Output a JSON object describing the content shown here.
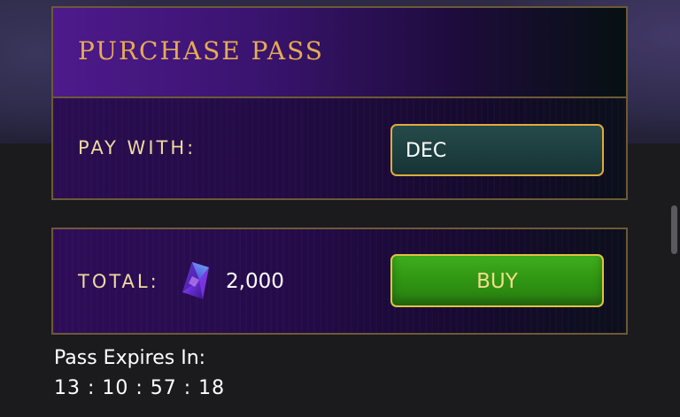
{
  "purchase": {
    "title": "PURCHASE PASS",
    "pay_with_label": "PAY WITH:",
    "currency_value": "DEC"
  },
  "total": {
    "label": "TOTAL:",
    "currency_icon": "gem-icon",
    "amount": "2,000",
    "buy_label": "BUY"
  },
  "expiry": {
    "label": "Pass Expires In:",
    "timer": "13 : 10 : 57 : 18"
  },
  "colors": {
    "accent_gold": "#e6ab55",
    "border_gold": "#6d5a36",
    "buy_green": "#2f9512",
    "select_teal": "#1c3d3e"
  }
}
